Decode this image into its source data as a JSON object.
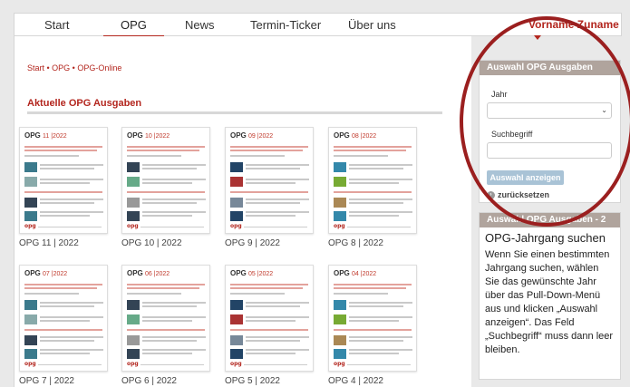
{
  "nav": {
    "items": [
      "Start",
      "OPG",
      "News",
      "Termin-Ticker",
      "Über uns"
    ],
    "user": "Vorname Zuname"
  },
  "breadcrumb": "Start • OPG • OPG-Online",
  "section_title": "Aktuelle OPG Ausgaben",
  "issues": [
    {
      "head": "OPG",
      "issue": "11 |2022",
      "label": "OPG 11 | 2022"
    },
    {
      "head": "OPG",
      "issue": "10 |2022",
      "label": "OPG 10 | 2022"
    },
    {
      "head": "OPG",
      "issue": "09 |2022",
      "label": "OPG 9 | 2022"
    },
    {
      "head": "OPG",
      "issue": "08 |2022",
      "label": "OPG 8 | 2022"
    },
    {
      "head": "OPG",
      "issue": "07 |2022",
      "label": "OPG 7 | 2022"
    },
    {
      "head": "OPG",
      "issue": "06 |2022",
      "label": "OPG 6 | 2022"
    },
    {
      "head": "OPG",
      "issue": "05 |2022",
      "label": "OPG 5 | 2022"
    },
    {
      "head": "OPG",
      "issue": "04 |2022",
      "label": "OPG 4 | 2022"
    }
  ],
  "thumb_footer": "opg",
  "sidebar": {
    "panel1_title": "Auswahl OPG Ausgaben",
    "year_label": "Jahr",
    "search_label": "Suchbegriff",
    "show_button": "Auswahl anzeigen",
    "reset_link": "zurücksetzen",
    "panel2_title": "Auswahl OPG Ausgaben - 2",
    "panel2_heading": "OPG-Jahrgang suchen",
    "panel2_text": "Wenn Sie einen bestimmten Jahrgang suchen, wählen Sie das gewünschte Jahr über das Pull-Down-Menü aus und klicken „Auswahl anzeigen“. Das Feld „Suchbegriff“ muss dann leer bleiben."
  },
  "colors": {
    "accent": "#b3261e",
    "panel_head": "#b0a49d",
    "button": "#a9c3d6",
    "highlight_circle": "#9b1f1f"
  }
}
